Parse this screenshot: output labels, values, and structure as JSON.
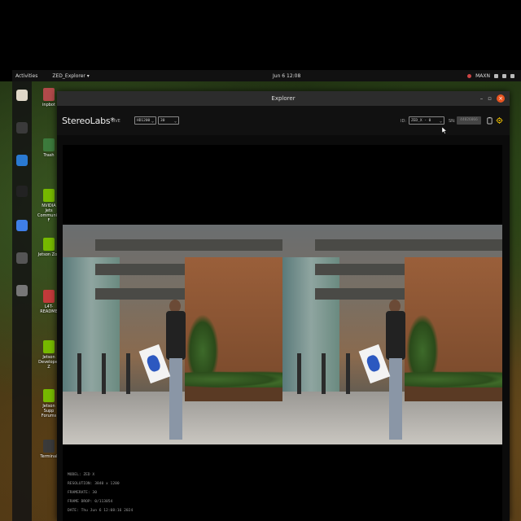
{
  "topbar": {
    "activities": "Activities",
    "app_menu": "ZED_Explorer ▾",
    "clock": "Jun 6 12:08",
    "power_mode": "MAXN"
  },
  "desktop_icons": [
    {
      "label": "inpbot",
      "color": "#b14a4a"
    },
    {
      "label": "Trash",
      "color": "#3c7a3c"
    },
    {
      "label": "NVIDIA Jets Community F",
      "color": "#76b900"
    },
    {
      "label": "Jetson Zoo",
      "color": "#76b900"
    },
    {
      "label": "L4T-README",
      "color": "#c23a3a"
    },
    {
      "label": "Jetson Developer Z",
      "color": "#76b900"
    },
    {
      "label": "Jetson Supp Forums",
      "color": "#76b900"
    },
    {
      "label": "Terminal",
      "color": "#3a3a3a"
    }
  ],
  "dock": [
    {
      "name": "files-icon",
      "color": "#e0d8c8"
    },
    {
      "name": "terminal-icon",
      "color": "#3a3a3a"
    },
    {
      "name": "vscode-icon",
      "color": "#2a7ad2"
    },
    {
      "name": "obs-icon",
      "color": "#222"
    },
    {
      "name": "chromium-icon",
      "color": "#3f7fe8"
    },
    {
      "name": "zed-explorer-icon",
      "color": "#555"
    },
    {
      "name": "drive-icon",
      "color": "#777"
    }
  ],
  "window": {
    "title": "Explorer",
    "minimize": "–",
    "maximize": "▫",
    "close": "×"
  },
  "toolbar": {
    "brand": "StereoLabs*",
    "live": "LIVE",
    "resolution": "HD1200",
    "fps": "30",
    "id_label": "ID:",
    "camera_id": "ZED_X - 0",
    "sn_label": "SN:",
    "sn_value": "44026066"
  },
  "info": {
    "model": "MODEL: ZED X",
    "resolution": "RESOLUTION: 3840 x 1200",
    "framerate": "FRAMERATE: 30",
    "frame_drop": "FRAME DROP: 0/113054",
    "date": "DATE: Thu Jun 6 12:08:16 2024"
  }
}
